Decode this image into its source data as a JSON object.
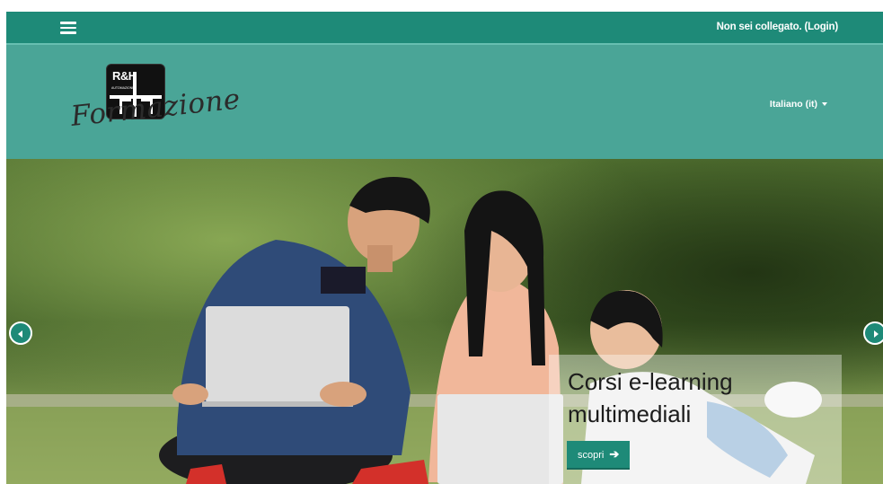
{
  "topbar": {
    "menu_icon": "hamburger-menu-icon",
    "login_text": "Non sei collegato. (Login)"
  },
  "header": {
    "logo_letters": "R&H",
    "logo_small_text": "AUTOMAZIONE",
    "logo_script": "Formazione",
    "language_label": "Italiano (it)",
    "caret_icon": "caret-down-icon"
  },
  "carousel": {
    "prev_icon": "chevron-left-icon",
    "next_icon": "chevron-right-icon",
    "caption_title": "Corsi e-learning multimediali",
    "caption_button": "scopri",
    "caption_button_icon": "arrow-right-icon"
  },
  "colors": {
    "topbar": "#1e8a78",
    "header": "#4aa597",
    "accent": "#1e8a78"
  }
}
